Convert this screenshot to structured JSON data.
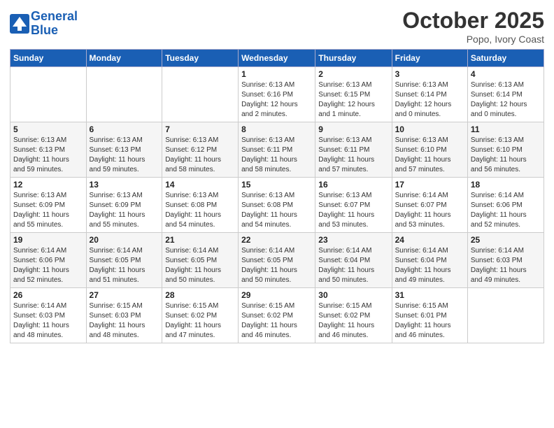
{
  "header": {
    "logo_line1": "General",
    "logo_line2": "Blue",
    "month": "October 2025",
    "location": "Popo, Ivory Coast"
  },
  "weekdays": [
    "Sunday",
    "Monday",
    "Tuesday",
    "Wednesday",
    "Thursday",
    "Friday",
    "Saturday"
  ],
  "weeks": [
    [
      {
        "day": "",
        "info": ""
      },
      {
        "day": "",
        "info": ""
      },
      {
        "day": "",
        "info": ""
      },
      {
        "day": "1",
        "info": "Sunrise: 6:13 AM\nSunset: 6:16 PM\nDaylight: 12 hours\nand 2 minutes."
      },
      {
        "day": "2",
        "info": "Sunrise: 6:13 AM\nSunset: 6:15 PM\nDaylight: 12 hours\nand 1 minute."
      },
      {
        "day": "3",
        "info": "Sunrise: 6:13 AM\nSunset: 6:14 PM\nDaylight: 12 hours\nand 0 minutes."
      },
      {
        "day": "4",
        "info": "Sunrise: 6:13 AM\nSunset: 6:14 PM\nDaylight: 12 hours\nand 0 minutes."
      }
    ],
    [
      {
        "day": "5",
        "info": "Sunrise: 6:13 AM\nSunset: 6:13 PM\nDaylight: 11 hours\nand 59 minutes."
      },
      {
        "day": "6",
        "info": "Sunrise: 6:13 AM\nSunset: 6:13 PM\nDaylight: 11 hours\nand 59 minutes."
      },
      {
        "day": "7",
        "info": "Sunrise: 6:13 AM\nSunset: 6:12 PM\nDaylight: 11 hours\nand 58 minutes."
      },
      {
        "day": "8",
        "info": "Sunrise: 6:13 AM\nSunset: 6:11 PM\nDaylight: 11 hours\nand 58 minutes."
      },
      {
        "day": "9",
        "info": "Sunrise: 6:13 AM\nSunset: 6:11 PM\nDaylight: 11 hours\nand 57 minutes."
      },
      {
        "day": "10",
        "info": "Sunrise: 6:13 AM\nSunset: 6:10 PM\nDaylight: 11 hours\nand 57 minutes."
      },
      {
        "day": "11",
        "info": "Sunrise: 6:13 AM\nSunset: 6:10 PM\nDaylight: 11 hours\nand 56 minutes."
      }
    ],
    [
      {
        "day": "12",
        "info": "Sunrise: 6:13 AM\nSunset: 6:09 PM\nDaylight: 11 hours\nand 55 minutes."
      },
      {
        "day": "13",
        "info": "Sunrise: 6:13 AM\nSunset: 6:09 PM\nDaylight: 11 hours\nand 55 minutes."
      },
      {
        "day": "14",
        "info": "Sunrise: 6:13 AM\nSunset: 6:08 PM\nDaylight: 11 hours\nand 54 minutes."
      },
      {
        "day": "15",
        "info": "Sunrise: 6:13 AM\nSunset: 6:08 PM\nDaylight: 11 hours\nand 54 minutes."
      },
      {
        "day": "16",
        "info": "Sunrise: 6:13 AM\nSunset: 6:07 PM\nDaylight: 11 hours\nand 53 minutes."
      },
      {
        "day": "17",
        "info": "Sunrise: 6:14 AM\nSunset: 6:07 PM\nDaylight: 11 hours\nand 53 minutes."
      },
      {
        "day": "18",
        "info": "Sunrise: 6:14 AM\nSunset: 6:06 PM\nDaylight: 11 hours\nand 52 minutes."
      }
    ],
    [
      {
        "day": "19",
        "info": "Sunrise: 6:14 AM\nSunset: 6:06 PM\nDaylight: 11 hours\nand 52 minutes."
      },
      {
        "day": "20",
        "info": "Sunrise: 6:14 AM\nSunset: 6:05 PM\nDaylight: 11 hours\nand 51 minutes."
      },
      {
        "day": "21",
        "info": "Sunrise: 6:14 AM\nSunset: 6:05 PM\nDaylight: 11 hours\nand 50 minutes."
      },
      {
        "day": "22",
        "info": "Sunrise: 6:14 AM\nSunset: 6:05 PM\nDaylight: 11 hours\nand 50 minutes."
      },
      {
        "day": "23",
        "info": "Sunrise: 6:14 AM\nSunset: 6:04 PM\nDaylight: 11 hours\nand 50 minutes."
      },
      {
        "day": "24",
        "info": "Sunrise: 6:14 AM\nSunset: 6:04 PM\nDaylight: 11 hours\nand 49 minutes."
      },
      {
        "day": "25",
        "info": "Sunrise: 6:14 AM\nSunset: 6:03 PM\nDaylight: 11 hours\nand 49 minutes."
      }
    ],
    [
      {
        "day": "26",
        "info": "Sunrise: 6:14 AM\nSunset: 6:03 PM\nDaylight: 11 hours\nand 48 minutes."
      },
      {
        "day": "27",
        "info": "Sunrise: 6:15 AM\nSunset: 6:03 PM\nDaylight: 11 hours\nand 48 minutes."
      },
      {
        "day": "28",
        "info": "Sunrise: 6:15 AM\nSunset: 6:02 PM\nDaylight: 11 hours\nand 47 minutes."
      },
      {
        "day": "29",
        "info": "Sunrise: 6:15 AM\nSunset: 6:02 PM\nDaylight: 11 hours\nand 46 minutes."
      },
      {
        "day": "30",
        "info": "Sunrise: 6:15 AM\nSunset: 6:02 PM\nDaylight: 11 hours\nand 46 minutes."
      },
      {
        "day": "31",
        "info": "Sunrise: 6:15 AM\nSunset: 6:01 PM\nDaylight: 11 hours\nand 46 minutes."
      },
      {
        "day": "",
        "info": ""
      }
    ]
  ]
}
